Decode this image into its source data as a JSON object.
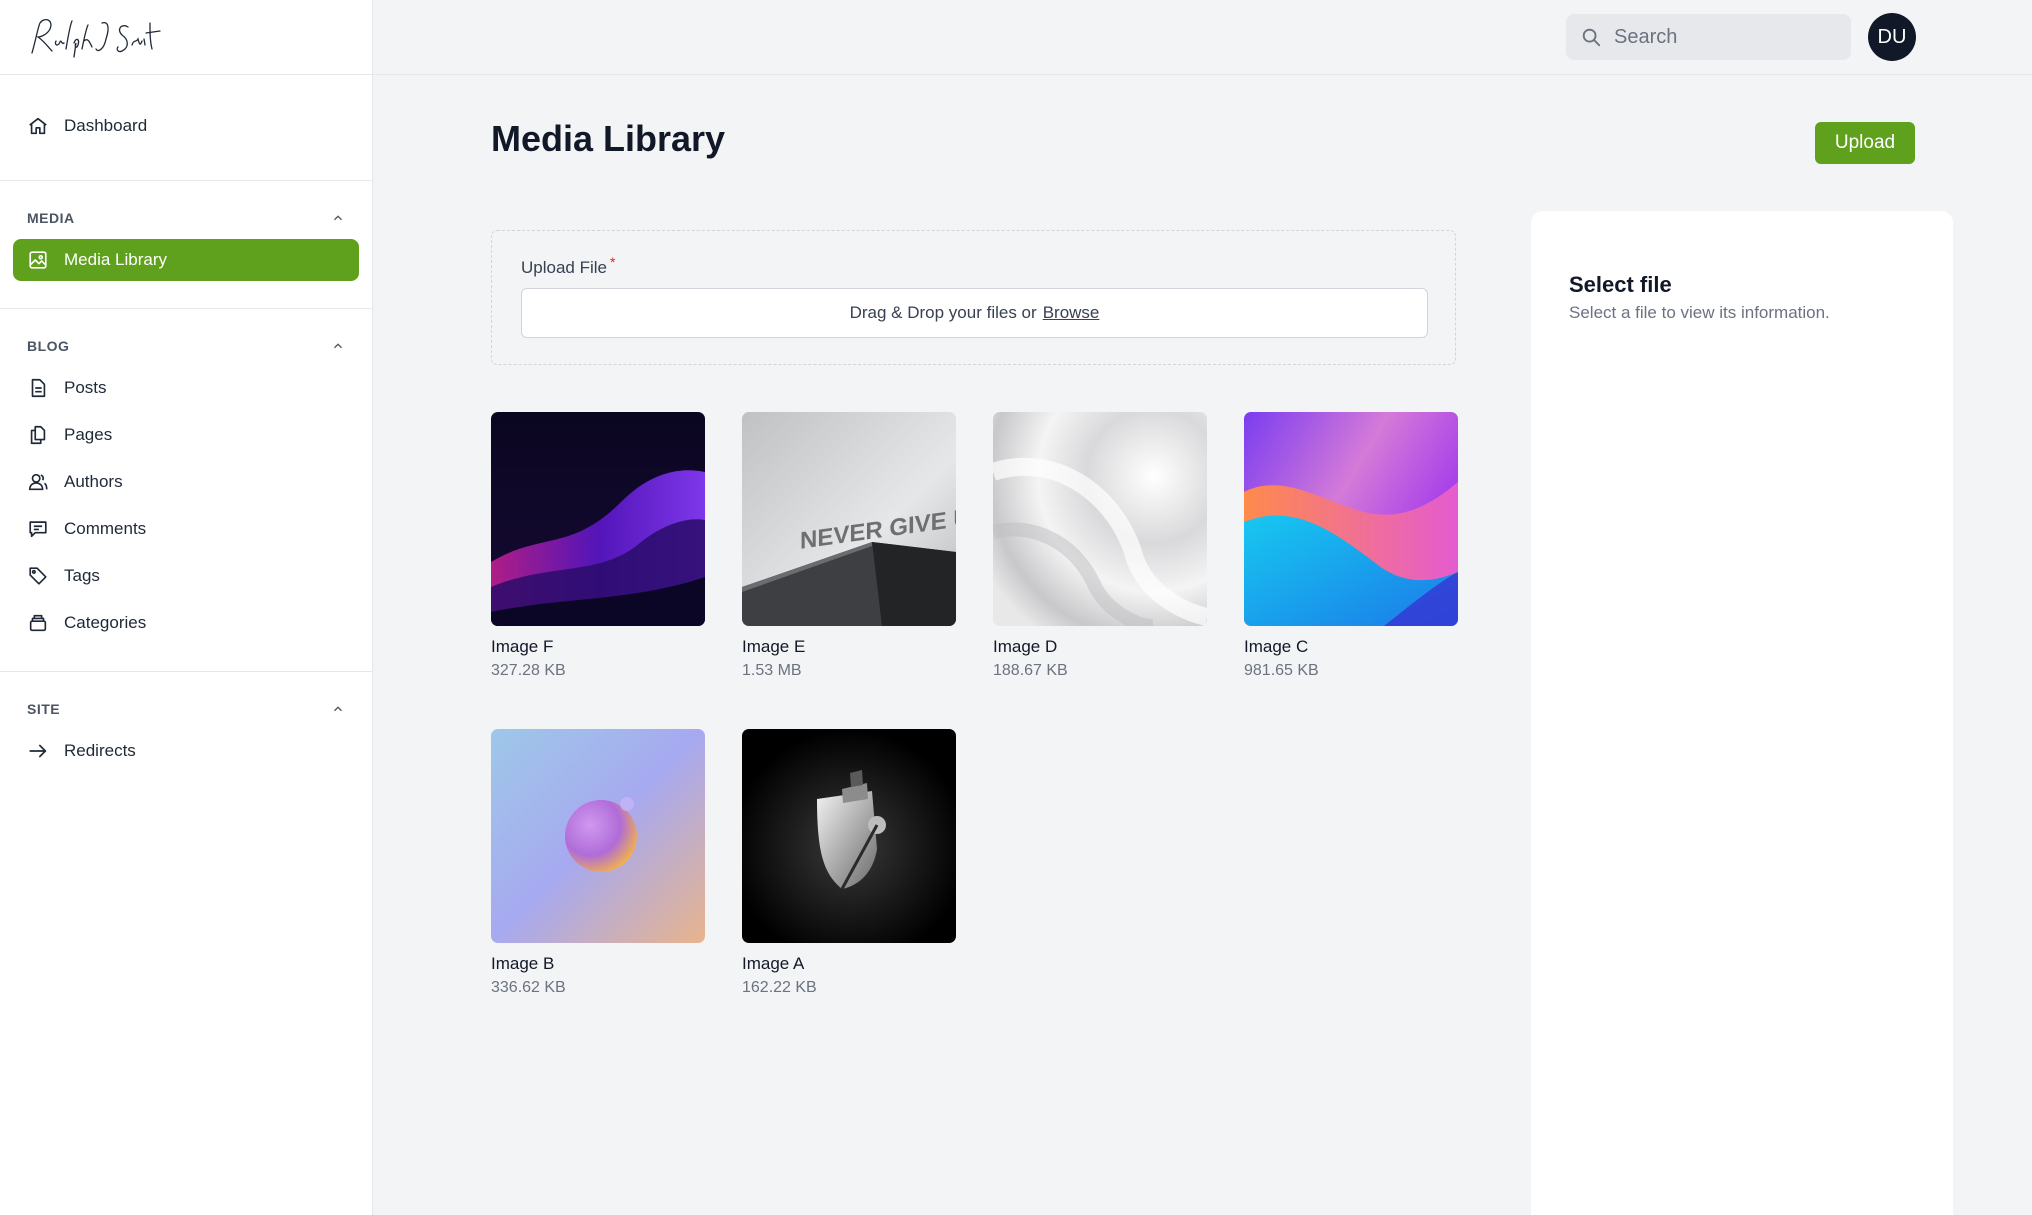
{
  "sidebar": {
    "logo_text": "Ralph J Smit",
    "top_items": [
      {
        "label": "Dashboard",
        "icon": "home-icon"
      }
    ],
    "sections": [
      {
        "title": "MEDIA",
        "items": [
          {
            "label": "Media Library",
            "icon": "image-icon",
            "active": true
          }
        ]
      },
      {
        "title": "BLOG",
        "items": [
          {
            "label": "Posts",
            "icon": "document-icon"
          },
          {
            "label": "Pages",
            "icon": "documents-icon"
          },
          {
            "label": "Authors",
            "icon": "users-icon"
          },
          {
            "label": "Comments",
            "icon": "comment-icon"
          },
          {
            "label": "Tags",
            "icon": "tag-icon"
          },
          {
            "label": "Categories",
            "icon": "stack-icon"
          }
        ]
      },
      {
        "title": "SITE",
        "items": [
          {
            "label": "Redirects",
            "icon": "arrow-right-icon"
          }
        ]
      }
    ]
  },
  "topbar": {
    "search_placeholder": "Search",
    "avatar_initials": "DU"
  },
  "main": {
    "title": "Media Library",
    "upload_label": "Upload",
    "dropzone": {
      "label": "Upload File",
      "required_mark": "*",
      "prompt": "Drag & Drop your files or",
      "browse": "Browse"
    },
    "files": [
      {
        "name": "Image F",
        "size": "327.28 KB"
      },
      {
        "name": "Image E",
        "size": "1.53 MB"
      },
      {
        "name": "Image D",
        "size": "188.67 KB"
      },
      {
        "name": "Image C",
        "size": "981.65 KB"
      },
      {
        "name": "Image B",
        "size": "336.62 KB"
      },
      {
        "name": "Image A",
        "size": "162.22 KB"
      }
    ],
    "thumb_text_e": "NEVER GIVE UP"
  },
  "panel": {
    "title": "Select file",
    "subtitle": "Select a file to view its information."
  },
  "colors": {
    "accent": "#5fa01c",
    "avatar_bg": "#111827",
    "required": "#dc2626"
  }
}
